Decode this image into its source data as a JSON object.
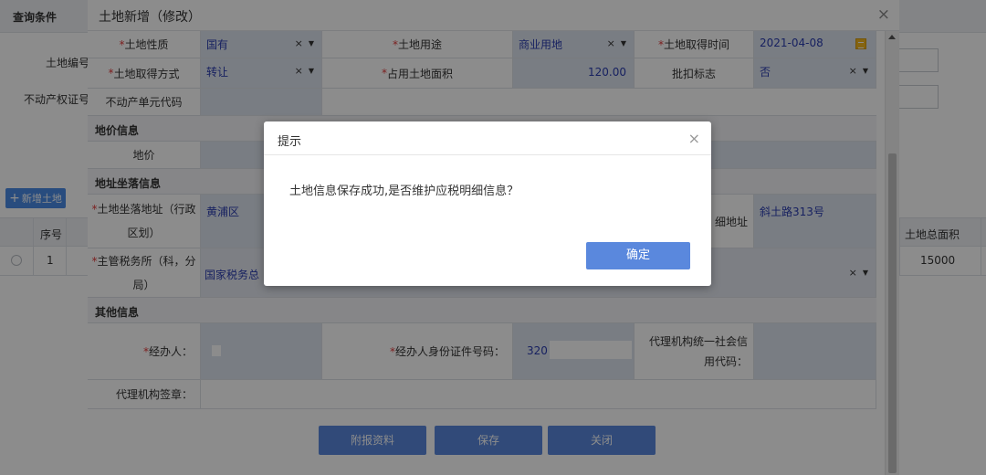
{
  "background": {
    "query_title": "查询条件",
    "land_no_label": "土地编号",
    "cert_no_label": "不动产权证号",
    "add_land_label": "新增土地",
    "table": {
      "headers": [
        "序号",
        "土地总面积"
      ],
      "row": {
        "index": "1",
        "total_area": "15000"
      }
    }
  },
  "modal": {
    "title": "土地新增（修改）",
    "close_glyph": "×",
    "fields": {
      "land_nature": {
        "label": "土地性质",
        "value": "国有"
      },
      "land_use": {
        "label": "土地用途",
        "value": "商业用地"
      },
      "acquire_time": {
        "label": "土地取得时间",
        "value": "2021-04-08"
      },
      "acquire_method": {
        "label": "土地取得方式",
        "value": "转让"
      },
      "occupied_area": {
        "label": "占用土地面积",
        "value": "120.00"
      },
      "deduct_flag": {
        "label": "批扣标志",
        "value": "否"
      },
      "property_unit_code": {
        "label": "不动产单元代码",
        "value": ""
      },
      "land_price": {
        "label": "地价",
        "value": ""
      },
      "location_address": {
        "label": "土地坐落地址（行政区划）",
        "value": "黄浦区"
      },
      "detail_address": {
        "label": "详细地址",
        "label_visible": "细地址",
        "value": "斜土路313号"
      },
      "tax_office": {
        "label": "主管税务所（科，分局）",
        "value": "国家税务总"
      },
      "handler": {
        "label": "经办人：",
        "value": ""
      },
      "handler_id": {
        "label": "经办人身份证件号码：",
        "value": "320"
      },
      "agency_code": {
        "label": "代理机构统一社会信用代码："
      },
      "agency_seal": {
        "label": "代理机构签章："
      }
    },
    "sections": {
      "price": "地价信息",
      "address": "地址坐落信息",
      "other": "其他信息"
    },
    "buttons": {
      "attach": "附报资料",
      "save": "保存",
      "close": "关闭"
    }
  },
  "dialog": {
    "title": "提示",
    "message": "土地信息保存成功,是否维护应税明细信息？",
    "ok": "确定",
    "close_glyph": "×"
  },
  "colors": {
    "accent": "#5a88dd",
    "required": "#e23b3b",
    "value_text": "#2a3cb0",
    "value_bg": "#dde3ee"
  }
}
